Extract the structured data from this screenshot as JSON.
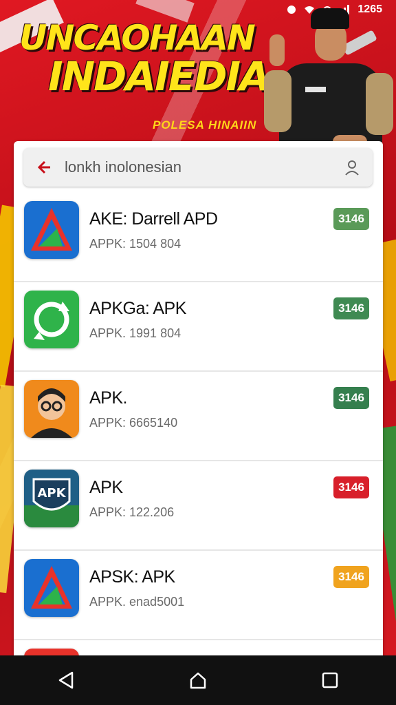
{
  "status_bar": {
    "time": "1265"
  },
  "banner": {
    "title_line1": "UNCAOHAAN",
    "title_line2": "INDAIEDIA",
    "subtitle": "POLESA HINAIIN"
  },
  "search": {
    "query": "lonkh inolonesian"
  },
  "apps": [
    {
      "name": "AKE: Darrell APD",
      "sub": "APPK: 1504 804",
      "tag": "3146",
      "tag_color": "#5a9a58",
      "icon": "triangle-a-icon"
    },
    {
      "name": "APKGa: APK",
      "sub": "APPK. 1991 804",
      "tag": "3146",
      "tag_color": "#3f8a52",
      "icon": "refresh-circle-icon"
    },
    {
      "name": "APK.",
      "sub": "APPK: 6665140",
      "tag": "3146",
      "tag_color": "#357f4e",
      "icon": "avatar-glasses-icon"
    },
    {
      "name": "APK",
      "sub": "APPK: 122.206",
      "tag": "3146",
      "tag_color": "#d81f2a",
      "icon": "apk-shield-icon"
    },
    {
      "name": "APSK: APK",
      "sub": "APPK. enad5001",
      "tag": "3146",
      "tag_color": "#f0a31e",
      "icon": "triangle-a-icon"
    },
    {
      "name": "",
      "sub": "",
      "tag": "",
      "tag_color": "#3f8a52",
      "icon": "partial-app-icon"
    }
  ],
  "nav": {
    "back": "back-icon",
    "home": "home-icon",
    "recents": "recents-icon"
  }
}
